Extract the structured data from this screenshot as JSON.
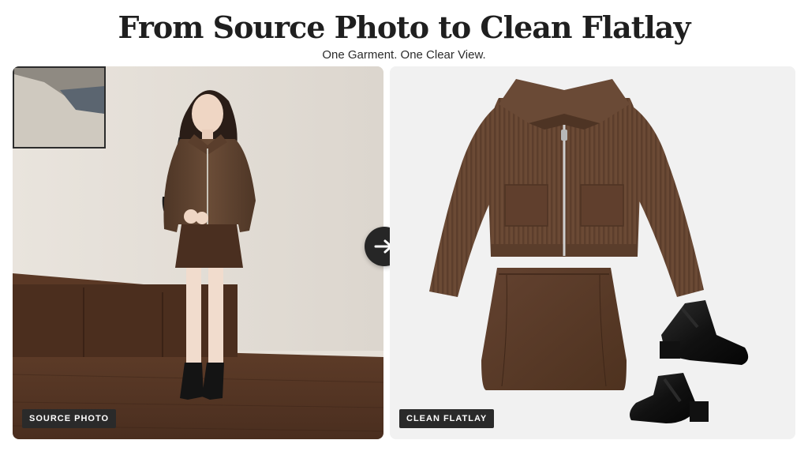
{
  "header": {
    "title": "From Source Photo to Clean Flatlay",
    "subtitle": "One Garment. One Clear View."
  },
  "panels": {
    "source": {
      "label": "SOURCE PHOTO"
    },
    "flatlay": {
      "label": "CLEAN FLATLAY"
    }
  },
  "arrow": {
    "icon": "arrow-right-icon"
  },
  "colors": {
    "title": "#1f1f1f",
    "tag_bg": "#2a2a2a",
    "sweater_brown": "#6b4a35",
    "skirt_brown": "#5a3a28",
    "arrow_bg": "#262626"
  }
}
